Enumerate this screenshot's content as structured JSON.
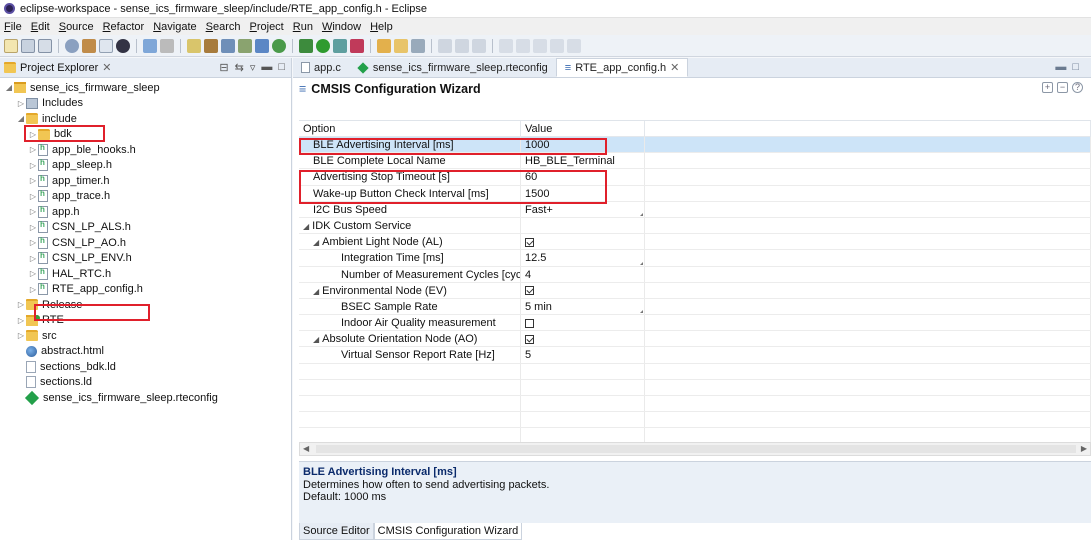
{
  "window": {
    "title": "eclipse-workspace - sense_ics_firmware_sleep/include/RTE_app_config.h - Eclipse"
  },
  "menu": [
    "File",
    "Edit",
    "Source",
    "Refactor",
    "Navigate",
    "Search",
    "Project",
    "Run",
    "Window",
    "Help"
  ],
  "project_explorer": {
    "title": "Project Explorer",
    "close_glyph": "✕",
    "tree": [
      {
        "label": "sense_ics_firmware_sleep",
        "icon": "project-icon",
        "level": 0,
        "expanded": true
      },
      {
        "label": "Includes",
        "icon": "includes-icon",
        "level": 1,
        "expanded": false
      },
      {
        "label": "include",
        "icon": "folder-icon",
        "level": 1,
        "expanded": true,
        "highlight": true
      },
      {
        "label": "bdk",
        "icon": "folder-icon",
        "level": 2,
        "expanded": false
      },
      {
        "label": "app_ble_hooks.h",
        "icon": "header-file-icon",
        "level": 2,
        "expanded": false
      },
      {
        "label": "app_sleep.h",
        "icon": "header-file-icon",
        "level": 2,
        "expanded": false
      },
      {
        "label": "app_timer.h",
        "icon": "header-file-icon",
        "level": 2,
        "expanded": false
      },
      {
        "label": "app_trace.h",
        "icon": "header-file-icon",
        "level": 2,
        "expanded": false
      },
      {
        "label": "app.h",
        "icon": "header-file-icon",
        "level": 2,
        "expanded": false
      },
      {
        "label": "CSN_LP_ALS.h",
        "icon": "header-file-icon",
        "level": 2,
        "expanded": false
      },
      {
        "label": "CSN_LP_AO.h",
        "icon": "header-file-icon",
        "level": 2,
        "expanded": false
      },
      {
        "label": "CSN_LP_ENV.h",
        "icon": "header-file-icon",
        "level": 2,
        "expanded": false
      },
      {
        "label": "HAL_RTC.h",
        "icon": "header-file-icon",
        "level": 2,
        "expanded": false
      },
      {
        "label": "RTE_app_config.h",
        "icon": "header-file-icon",
        "level": 2,
        "expanded": false,
        "highlight": true
      },
      {
        "label": "Release",
        "icon": "folder-icon",
        "level": 1,
        "expanded": false
      },
      {
        "label": "RTE",
        "icon": "rte-folder-icon",
        "level": 1,
        "expanded": false
      },
      {
        "label": "src",
        "icon": "folder-icon",
        "level": 1,
        "expanded": false
      },
      {
        "label": "abstract.html",
        "icon": "html-file-icon",
        "level": 1,
        "leaf": true
      },
      {
        "label": "sections_bdk.ld",
        "icon": "linker-file-icon",
        "level": 1,
        "leaf": true
      },
      {
        "label": "sections.ld",
        "icon": "linker-file-icon",
        "level": 1,
        "leaf": true
      },
      {
        "label": "sense_ics_firmware_sleep.rteconfig",
        "icon": "rteconfig-icon",
        "level": 1,
        "leaf": true
      }
    ]
  },
  "editor_tabs": [
    {
      "label": "app.c",
      "icon": "c-file-icon",
      "active": false
    },
    {
      "label": "sense_ics_firmware_sleep.rteconfig",
      "icon": "rteconfig-icon",
      "active": false
    },
    {
      "label": "RTE_app_config.h",
      "icon": "wizard-icon",
      "active": true,
      "close": "✕"
    }
  ],
  "wizard": {
    "title": "CMSIS Configuration Wizard",
    "columns": [
      "Option",
      "Value"
    ],
    "rows": [
      {
        "option": "BLE Advertising Interval [ms]",
        "value": "1000",
        "indent": 0,
        "selected": true,
        "highlight": true
      },
      {
        "option": "BLE Complete Local Name",
        "value": "HB_BLE_Terminal",
        "indent": 0
      },
      {
        "option": "Advertising Stop Timeout [s]",
        "value": "60",
        "indent": 0,
        "highlight": true
      },
      {
        "option": "Wake-up Button Check Interval [ms]",
        "value": "1500",
        "indent": 0,
        "highlight": true
      },
      {
        "option": "I2C Bus Speed",
        "value": "Fast+",
        "indent": 0,
        "dropdown": true
      },
      {
        "option": "IDK Custom Service",
        "value": "",
        "indent": 0,
        "group": true
      },
      {
        "option": "Ambient Light Node (AL)",
        "value": "",
        "indent": 1,
        "group": true,
        "checkbox": true,
        "checked": true
      },
      {
        "option": "Integration Time [ms]",
        "value": "12.5",
        "indent": 2,
        "dropdown": true
      },
      {
        "option": "Number of Measurement Cycles [cycles]",
        "value": "4",
        "indent": 2
      },
      {
        "option": "Environmental Node (EV)",
        "value": "",
        "indent": 1,
        "group": true,
        "checkbox": true,
        "checked": true
      },
      {
        "option": "BSEC Sample Rate",
        "value": "5 min",
        "indent": 2,
        "dropdown": true
      },
      {
        "option": "Indoor Air Quality measurement",
        "value": "",
        "indent": 2,
        "checkbox": true,
        "checked": false
      },
      {
        "option": "Absolute Orientation Node (AO)",
        "value": "",
        "indent": 1,
        "group": true,
        "checkbox": true,
        "checked": true
      },
      {
        "option": "Virtual Sensor Report Rate [Hz]",
        "value": "5",
        "indent": 2
      }
    ],
    "empty_rows": 6,
    "description": {
      "title": "BLE Advertising Interval [ms]",
      "text": "Determines how often to send advertising packets.",
      "default": "Default: 1000 ms"
    }
  },
  "bottom_tabs": [
    {
      "label": "Source Editor",
      "active": false
    },
    {
      "label": "CMSIS Configuration Wizard",
      "active": true
    }
  ]
}
